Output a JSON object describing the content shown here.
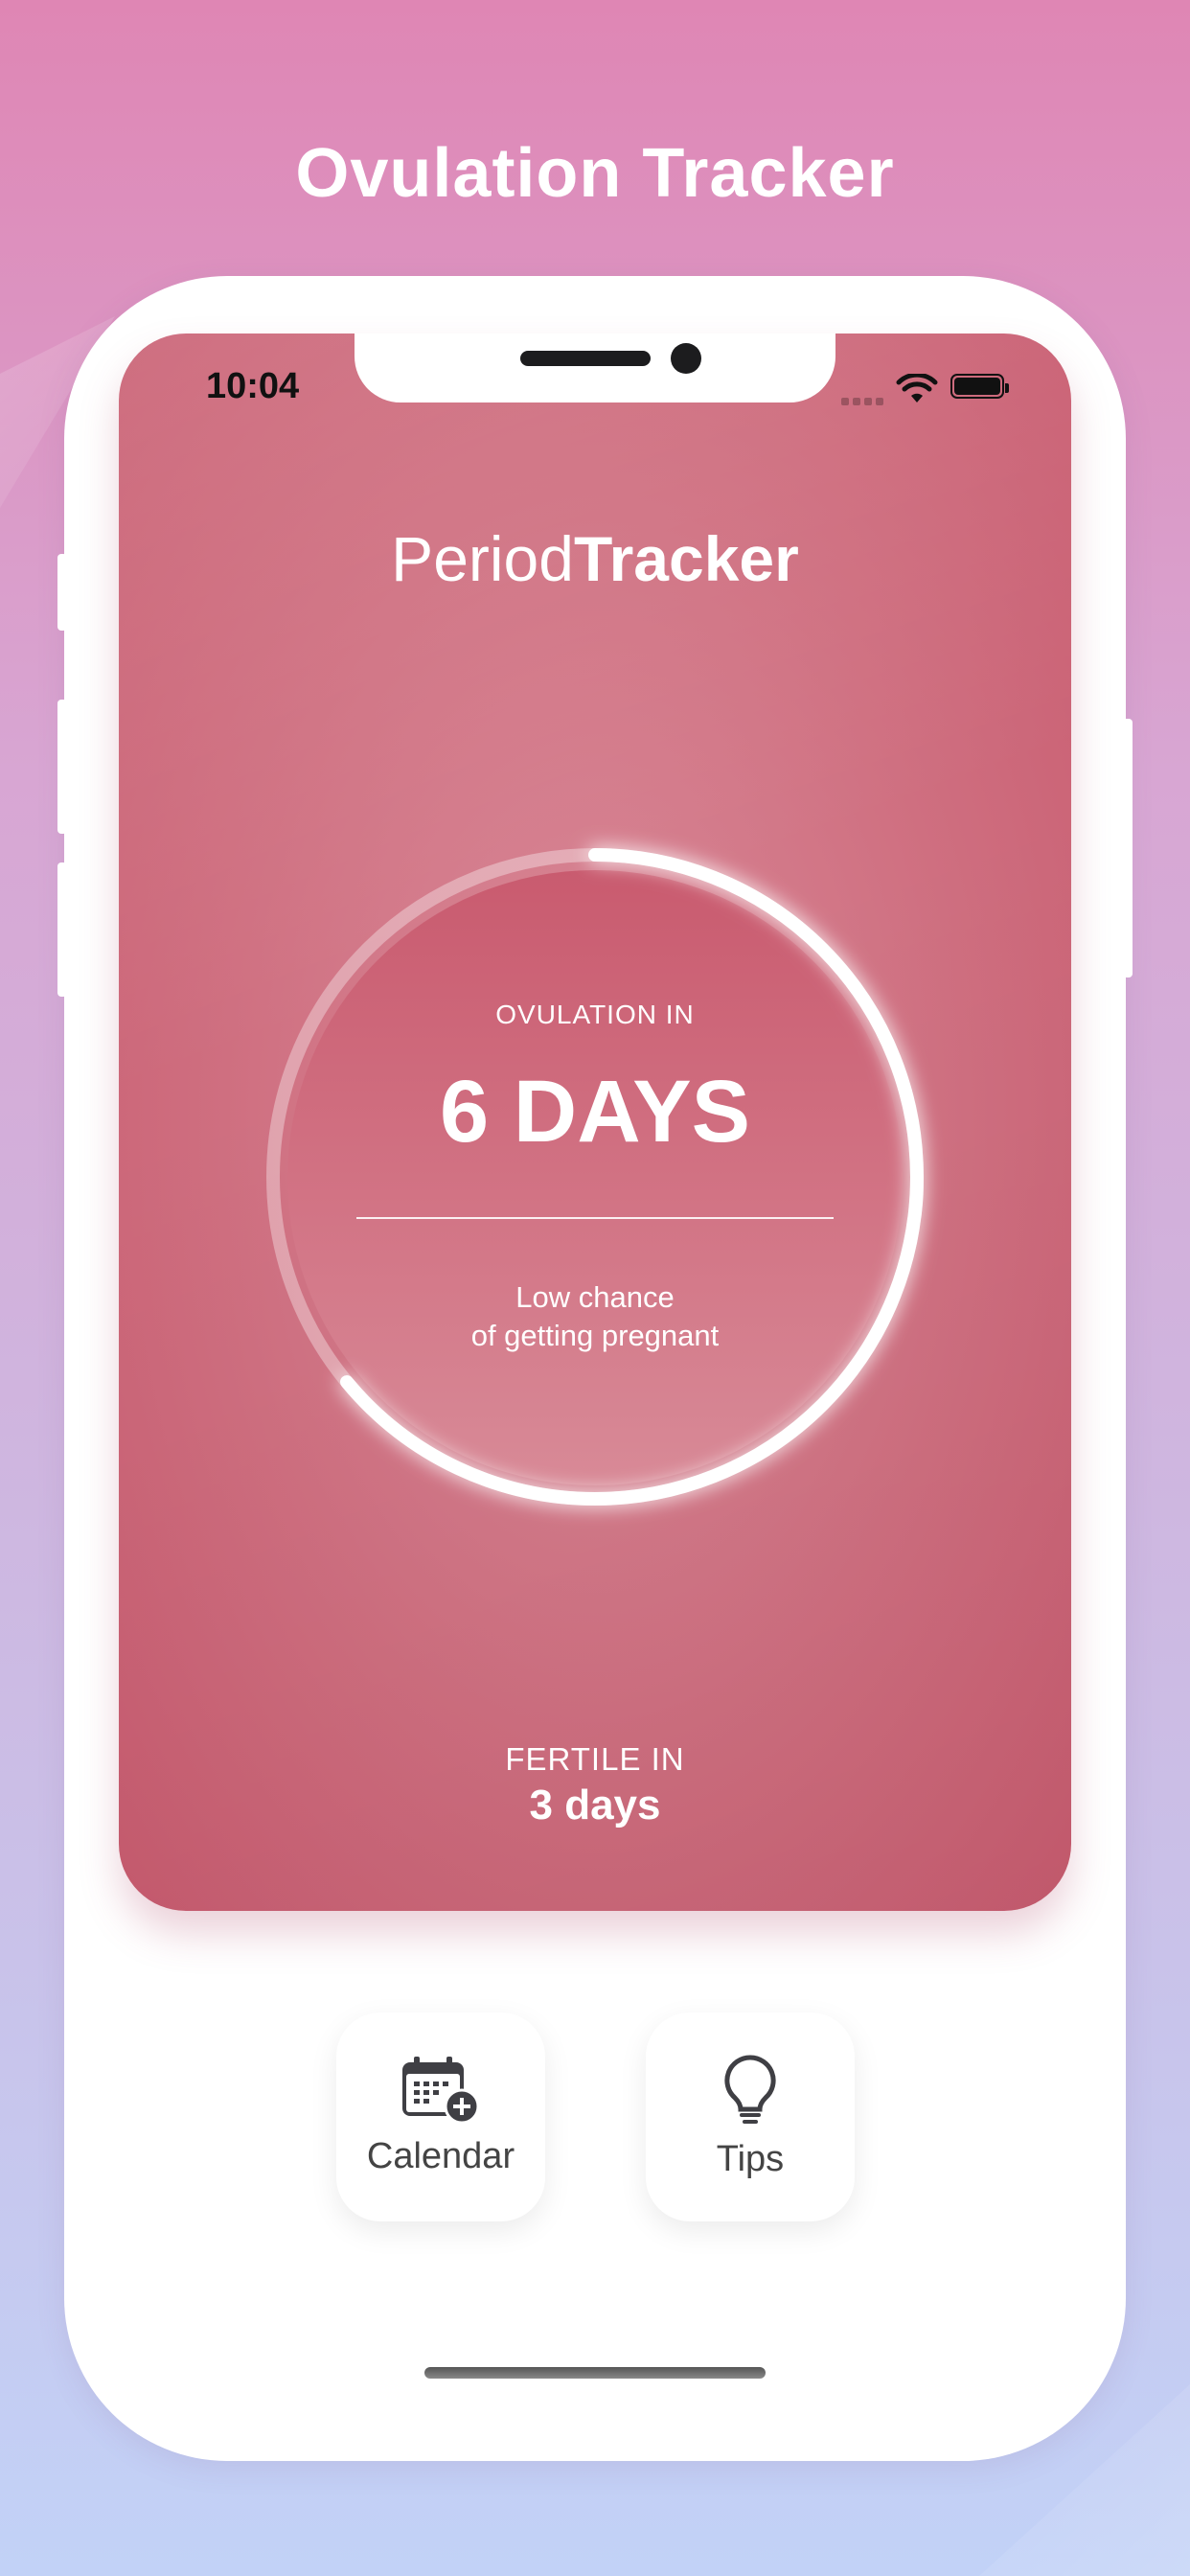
{
  "page_title": "Ovulation Tracker",
  "status_bar": {
    "time": "10:04"
  },
  "app_brand": {
    "part1": "Period",
    "part2": "Tracker"
  },
  "ovulation": {
    "label": "OVULATION IN",
    "value": "6 DAYS",
    "chance_line1": "Low chance",
    "chance_line2": "of getting pregnant",
    "cycle_progress": 0.36
  },
  "fertile": {
    "label": "FERTILE IN",
    "value": "3 days"
  },
  "actions": [
    {
      "label": "Calendar",
      "icon": "calendar-add-icon"
    },
    {
      "label": "Tips",
      "icon": "lightbulb-icon"
    }
  ],
  "colors": {
    "card_top": "#d7808d",
    "card_bottom": "#c85b6f",
    "ring": "#ffffff",
    "title": "#ffffff"
  }
}
